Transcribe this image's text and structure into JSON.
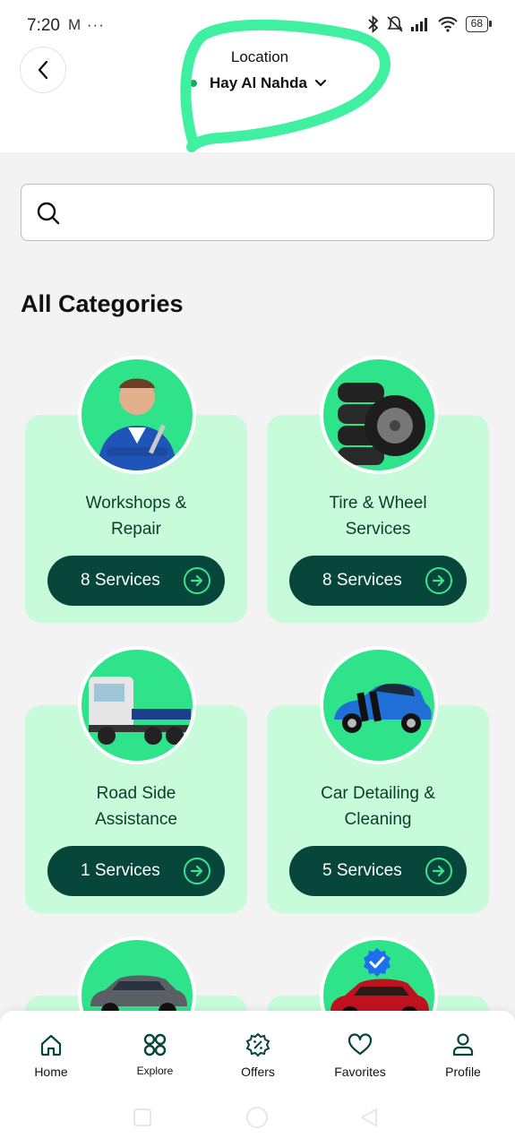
{
  "status_bar": {
    "time": "7:20",
    "left_icons": "M ···",
    "battery": "68"
  },
  "header": {
    "location_label": "Location",
    "location_value": "Hay Al Nahda"
  },
  "search": {
    "placeholder": ""
  },
  "section": {
    "title": "All Categories"
  },
  "categories": [
    {
      "title_line1": "Workshops &",
      "title_line2": "Repair",
      "services": "8 Services",
      "image": "mechanic-image"
    },
    {
      "title_line1": "Tire & Wheel",
      "title_line2": "Services",
      "services": "8 Services",
      "image": "tires-image"
    },
    {
      "title_line1": "Road Side",
      "title_line2": "Assistance",
      "services": "1 Services",
      "image": "tow-truck-image"
    },
    {
      "title_line1": "Car Detailing &",
      "title_line2": "Cleaning",
      "services": "5 Services",
      "image": "sports-car-image"
    },
    {
      "image": "suv-image"
    },
    {
      "image": "red-suv-image"
    }
  ],
  "bottom_nav": [
    {
      "label": "Home",
      "icon": "home-icon",
      "active": true
    },
    {
      "label": "Explore",
      "icon": "grid-icon"
    },
    {
      "label": "Offers",
      "icon": "discount-icon"
    },
    {
      "label": "Favorites",
      "icon": "heart-icon"
    },
    {
      "label": "Profile",
      "icon": "profile-icon"
    }
  ],
  "colors": {
    "accent": "#07463a",
    "card_bg": "#c8fbd9",
    "circle_bg": "#2fe38a",
    "annotation": "#3ef0a0"
  }
}
